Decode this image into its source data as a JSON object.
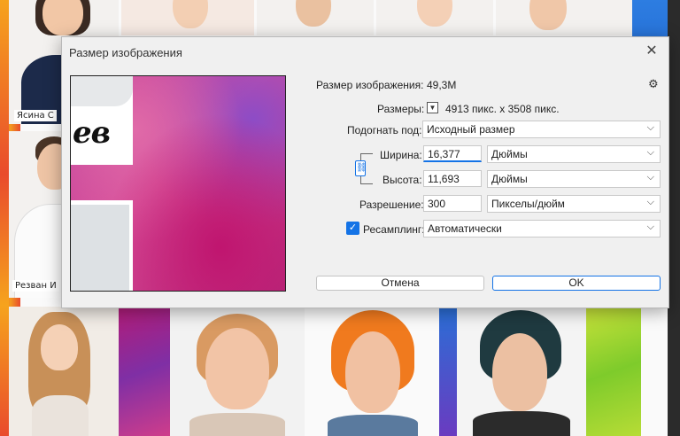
{
  "dialog": {
    "title": "Размер изображения",
    "image_size_label": "Размер изображения:",
    "image_size_value": "49,3M",
    "dimensions_label": "Размеры:",
    "dimensions_value": "4913 пикс. x 3508 пикс.",
    "fit_to_label": "Подогнать под:",
    "fit_to_value": "Исходный размер",
    "width_label": "Ширина:",
    "width_value": "16,377",
    "width_unit": "Дюймы",
    "height_label": "Высота:",
    "height_value": "11,693",
    "height_unit": "Дюймы",
    "resolution_label": "Разрешение:",
    "resolution_value": "300",
    "resolution_unit": "Пикселы/дюйм",
    "resample_label": "Ресамплинг:",
    "resample_checked": true,
    "resample_value": "Автоматически",
    "cancel_label": "Отмена",
    "ok_label": "OK",
    "preview_text": "ев",
    "icons": {
      "close": "close-icon",
      "gear": "gear-icon",
      "chevron": "chevron-down-icon",
      "link": "link-icon",
      "check": "checkmark-icon"
    }
  },
  "background": {
    "name_tag_1": "Ясина С",
    "name_tag_2": "Резван И"
  },
  "colors": {
    "accent": "#1473e6",
    "dialog_bg": "#f0f0f0"
  }
}
